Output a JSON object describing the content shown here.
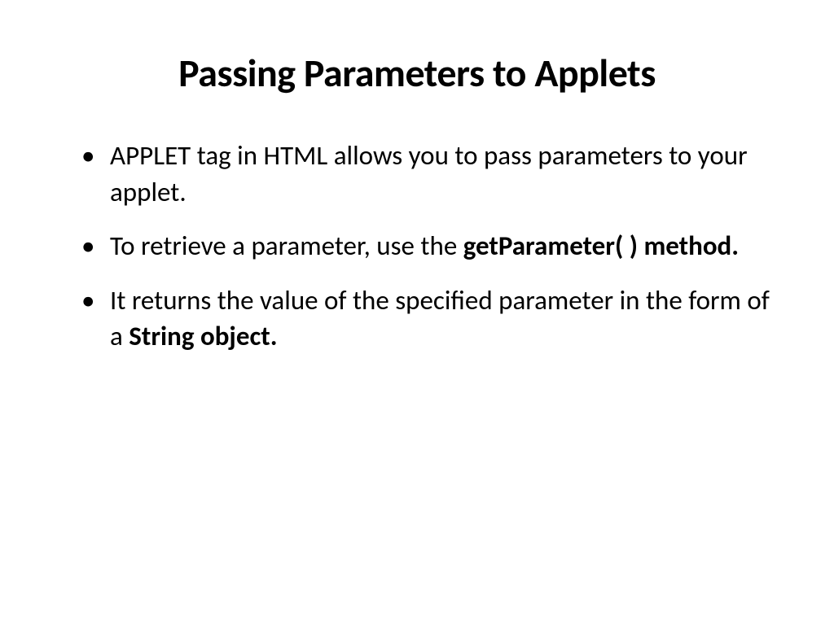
{
  "slide": {
    "title": "Passing Parameters to Applets",
    "bullets": [
      {
        "text_before": "APPLET tag in HTML allows you to pass parameters to your applet.",
        "bold_part": "",
        "text_after": ""
      },
      {
        "text_before": "To retrieve a parameter, use the ",
        "bold_part": "getParameter( ) method.",
        "text_after": ""
      },
      {
        "text_before": "It returns the value of the specified parameter in the form of a ",
        "bold_part": "String object.",
        "text_after": ""
      }
    ]
  }
}
